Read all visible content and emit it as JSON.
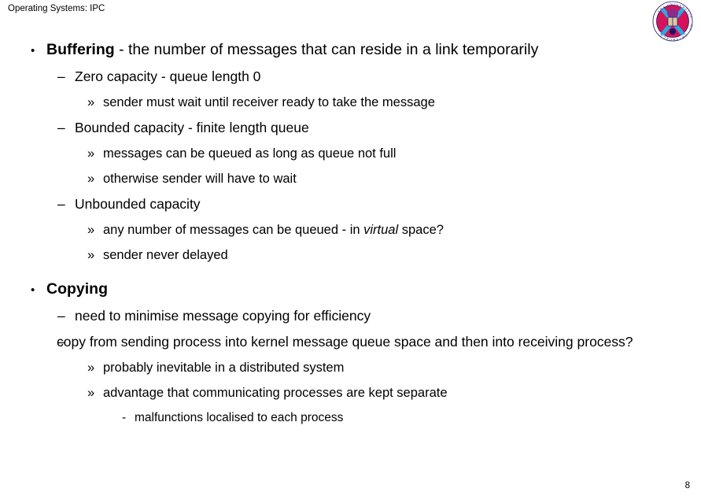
{
  "slide": {
    "header": "Operating Systems: IPC",
    "page_number": "8",
    "background_color": "#ffffff",
    "text_color": "#000000"
  },
  "logo": {
    "name": "university-of-edinburgh-crest",
    "ring_text": "THE UNIVERSITY OF EDINBURGH",
    "colors": {
      "circle": "#d4145a",
      "ring": "#ffffff",
      "saltire": "#29abe2",
      "book": "#d9c9a3",
      "outline": "#1b1464"
    }
  },
  "content": {
    "bullet_markers": {
      "level1": "•",
      "level2": "–",
      "level3": "»",
      "level4": "-"
    },
    "items": [
      {
        "level": 1,
        "bold_lead": "Buffering",
        "rest": " - the number of messages that can reside in a link temporarily"
      },
      {
        "level": 2,
        "text": "Zero capacity - queue length 0"
      },
      {
        "level": 3,
        "text": "sender must wait until receiver ready to take the message"
      },
      {
        "level": 2,
        "text": "Bounded capacity - finite length queue"
      },
      {
        "level": 3,
        "text": "messages can be queued as long as queue not full"
      },
      {
        "level": 3,
        "text": "otherwise sender will have to wait"
      },
      {
        "level": 2,
        "text": "Unbounded capacity"
      },
      {
        "level": 3,
        "pre": "any number of messages can be queued - in ",
        "italic": "virtual",
        "post": " space?"
      },
      {
        "level": 3,
        "text": "sender never delayed"
      },
      {
        "level": 1,
        "bold_lead": "Copying",
        "rest": ""
      },
      {
        "level": 2,
        "text": "need to minimise message copying for efficiency"
      },
      {
        "level": 2,
        "text": "copy from sending process into kernel message queue space and then into receiving process?"
      },
      {
        "level": 3,
        "text": "probably inevitable in a distributed system"
      },
      {
        "level": 3,
        "text": "advantage that communicating processes are kept separate"
      },
      {
        "level": 4,
        "text": "malfunctions localised to each process"
      }
    ]
  }
}
